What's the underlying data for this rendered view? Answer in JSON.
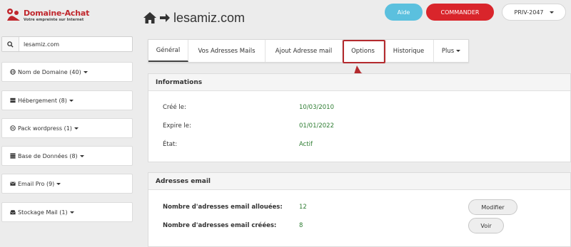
{
  "brand": {
    "name": "Domaine-Achat",
    "tagline": "Votre empreinte sur Internet"
  },
  "search": {
    "value": "lesamiz.com",
    "placeholder": ""
  },
  "sidebar": {
    "items": [
      {
        "label": "Nom de Domaine (40)",
        "icon": "globe-icon"
      },
      {
        "label": "Hébergement (8)",
        "icon": "server-icon"
      },
      {
        "label": "Pack wordpress (1)",
        "icon": "wordpress-icon"
      },
      {
        "label": "Base de Données (8)",
        "icon": "database-icon"
      },
      {
        "label": "Email Pro (9)",
        "icon": "envelope-icon"
      },
      {
        "label": "Stockage Mail (1)",
        "icon": "inbox-icon"
      }
    ]
  },
  "header": {
    "domain": "lesamiz.com",
    "aide_label": "Aide",
    "commander_label": "COMMANDER",
    "account_label": "PRIV-2047"
  },
  "tabs": [
    {
      "label": "Général",
      "active": true
    },
    {
      "label": "Vos Adresses Mails",
      "active": false
    },
    {
      "label": "Ajout Adresse mail",
      "active": false
    },
    {
      "label": "Options",
      "active": false,
      "highlighted": true
    },
    {
      "label": "Historique",
      "active": false
    },
    {
      "label": "Plus",
      "active": false
    }
  ],
  "informations": {
    "title": "Informations",
    "rows": [
      {
        "label": "Créé le:",
        "value": "10/03/2010"
      },
      {
        "label": "Expire le:",
        "value": "01/01/2022"
      },
      {
        "label": "État:",
        "value": "Actif"
      }
    ]
  },
  "adresses": {
    "title": "Adresses email",
    "rows": [
      {
        "label": "Nombre d'adresses email allouées:",
        "value": "12",
        "button": "Modifier"
      },
      {
        "label": "Nombre d'adresses email créées:",
        "value": "8",
        "button": "Voir"
      }
    ]
  },
  "colors": {
    "brand_red": "#d9252b",
    "aide_blue": "#5bc0de",
    "value_green": "#2e7d32",
    "annotation_red": "#b42a2e"
  }
}
